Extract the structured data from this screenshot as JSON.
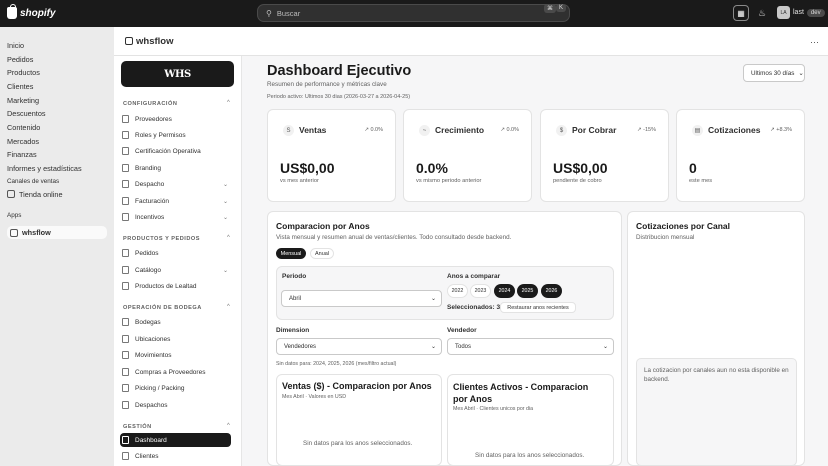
{
  "topbar": {
    "brand": "shopify",
    "search_placeholder": "Buscar",
    "shortcut_keys": [
      "⌘",
      "K"
    ],
    "user": "last",
    "user_initials": "LA",
    "dev_badge": "dev"
  },
  "sidebar": {
    "items": [
      "Inicio",
      "Pedidos",
      "Productos",
      "Clientes",
      "Marketing",
      "Descuentos",
      "Contenido",
      "Mercados",
      "Finanzas",
      "Informes y estadísticas"
    ],
    "sales_channels_label": "Canales de ventas",
    "channels": [
      "Tienda online"
    ],
    "apps_label": "Apps",
    "apps": [
      "whsflow"
    ]
  },
  "app": {
    "title": "whsflow",
    "brand_logo": "WHS",
    "sections": [
      {
        "label": "CONFIGURACIÓN",
        "items": [
          "Proveedores",
          "Roles y Permisos",
          "Certificación Operativa",
          "Branding",
          "Despacho",
          "Facturación",
          "Incentivos"
        ]
      },
      {
        "label": "PRODUCTOS Y PEDIDOS",
        "items": [
          "Pedidos",
          "Catálogo",
          "Productos de Lealtad"
        ]
      },
      {
        "label": "OPERACIÓN DE BODEGA",
        "items": [
          "Bodegas",
          "Ubicaciones",
          "Movimientos",
          "Compras a Proveedores",
          "Picking / Packing",
          "Despachos"
        ]
      },
      {
        "label": "GESTIÓN",
        "items": [
          "Dashboard",
          "Clientes"
        ]
      }
    ]
  },
  "dashboard": {
    "title": "Dashboard Ejecutivo",
    "subtitle": "Resumen de performance y métricas clave",
    "period": "Periodo activo: Ultimos 30 dias (2026-03-27 a 2026-04-25)",
    "range": "Ultimos 30 días",
    "kpis": [
      {
        "title": "Ventas",
        "delta": "0.0%",
        "value": "US$0,00",
        "note": "vs mes anterior",
        "icon": "S"
      },
      {
        "title": "Crecimiento",
        "delta": "0.0%",
        "value": "0.0%",
        "note": "vs mismo periodo anterior",
        "icon": "~"
      },
      {
        "title": "Por Cobrar",
        "delta": "-15%",
        "value": "US$0,00",
        "note": "pendiente de cobro",
        "icon": "$"
      },
      {
        "title": "Cotizaciones",
        "delta": "+8.3%",
        "value": "0",
        "note": "este mes",
        "icon": "▤"
      }
    ],
    "compare": {
      "title": "Comparacion por Anos",
      "subtitle": "Vista mensual y resumen anual de ventas/clientes. Todo consultado desde backend.",
      "tabs": [
        "Mensual",
        "Anual"
      ],
      "period_label": "Periodo",
      "period_value": "Abril",
      "years_label": "Anos a comparar",
      "years": [
        "2022",
        "2023",
        "2024",
        "2025",
        "2026"
      ],
      "selected_years": [
        "2024",
        "2025",
        "2026"
      ],
      "selected_count": "Seleccionados: 3",
      "restore": "Restaurar anos recientes",
      "dimension_label": "Dimension",
      "dimension_value": "Vendedores",
      "seller_label": "Vendedor",
      "seller_value": "Todos",
      "no_data_note": "Sin datos para: 2024, 2025, 2026 (mes/filtro actual)",
      "sales_card": {
        "title": "Ventas ($) - Comparacion por Anos",
        "subtitle": "Mes Abril · Valores en USD",
        "empty": "Sin datos para los anos seleccionados."
      },
      "clients_card": {
        "title": "Clientes Activos - Comparacion por Anos",
        "subtitle": "Mes Abril · Clientes unicos por dia",
        "empty": "Sin datos para los anos seleccionados."
      }
    },
    "channel": {
      "title": "Cotizaciones por Canal",
      "subtitle": "Distribucion mensual",
      "note": "La cotizacion por canales aun no esta disponible en backend."
    }
  }
}
